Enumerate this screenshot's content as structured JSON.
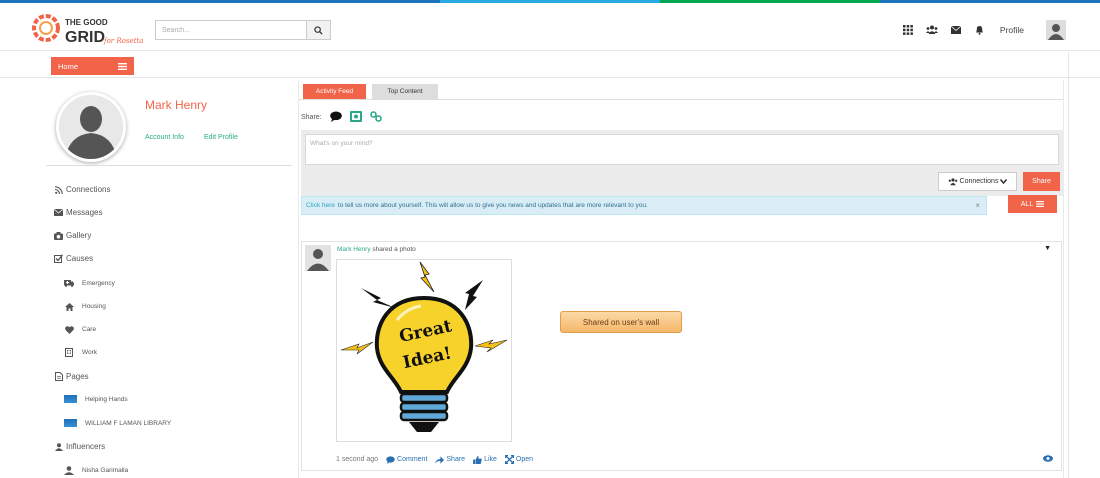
{
  "brand": {
    "line1": "THE GOOD",
    "line2": "GRID",
    "tagline": "for Rosetta",
    "accent": "#f26449",
    "teal": "#2aa889"
  },
  "search": {
    "placeholder": "Search..."
  },
  "header": {
    "profile_label": "Profile",
    "icons": [
      "grid-icon",
      "users-icon",
      "envelope-icon",
      "bell-icon"
    ]
  },
  "subnav": {
    "home_label": "Home"
  },
  "user": {
    "name": "Mark Henry",
    "account_info": "Account Info",
    "edit_profile": "Edit Profile"
  },
  "sidebar": {
    "connections": "Connections",
    "messages": "Messages",
    "gallery": "Gallery",
    "causes": "Causes",
    "causes_items": [
      "Emergency",
      "Housing",
      "Care",
      "Work"
    ],
    "pages": "Pages",
    "pages_items": [
      "Helping Hands",
      "WILLIAM F LAMAN LIBRARY"
    ],
    "influencers": "Influencers",
    "influencers_items": [
      "Nisha Garimalla"
    ]
  },
  "tabs": {
    "activity": "Activity Feed",
    "top": "Top Content"
  },
  "composer": {
    "share_label": "Share:",
    "placeholder": "What's on your mind?",
    "connections_label": "Connections",
    "share_button": "Share"
  },
  "info": {
    "link": "Click here",
    "text": "to tell us more about yourself. This will allow us to give you news and updates that are more relevant to you.",
    "close": "×"
  },
  "filter": {
    "label": "ALL"
  },
  "post": {
    "author": "Mark Henry",
    "action": "shared a photo",
    "time": "1 second ago",
    "comment": "Comment",
    "share": "Share",
    "like": "Like",
    "open": "Open",
    "image_text_1": "Great",
    "image_text_2": "Idea!"
  },
  "callout": {
    "text": "Shared on user's wall"
  }
}
